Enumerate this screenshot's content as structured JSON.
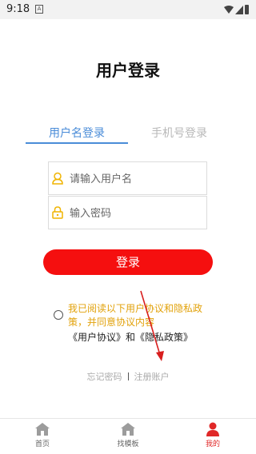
{
  "status_bar": {
    "time": "9:18",
    "notification_icon": "A"
  },
  "page": {
    "title": "用户登录"
  },
  "tabs": [
    {
      "label": "用户名登录",
      "active": true
    },
    {
      "label": "手机号登录",
      "active": false
    }
  ],
  "form": {
    "username": {
      "value": "",
      "placeholder": "请输入用户名",
      "icon": "user-icon"
    },
    "password": {
      "value": "",
      "placeholder": "输入密码",
      "icon": "lock-icon"
    },
    "login_label": "登录"
  },
  "agreement": {
    "checked": false,
    "text": "我已阅读以下用户协议和隐私政策，并同意协议内容",
    "user_agreement_link": "《用户协议》",
    "joiner": "和",
    "privacy_link": "《隐私政策》"
  },
  "links": {
    "forgot_password": "忘记密码",
    "register": "注册账户"
  },
  "bottom_nav": [
    {
      "label": "首页",
      "icon": "home-icon",
      "active": false
    },
    {
      "label": "找模板",
      "icon": "home-icon",
      "active": false
    },
    {
      "label": "我的",
      "icon": "person-icon",
      "active": true
    }
  ],
  "colors": {
    "accent": "#4a8cd8",
    "primary": "#f50f0f",
    "agreement_text": "#e2a20b",
    "annotation_arrow": "#d81e1e"
  }
}
